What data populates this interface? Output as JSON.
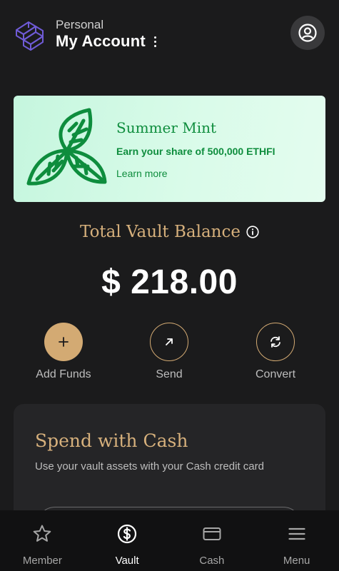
{
  "header": {
    "account_type": "Personal",
    "account_name": "My Account"
  },
  "promo": {
    "title": "Summer Mint",
    "subtitle": "Earn your share of 500,000 ETHFI",
    "link": "Learn more",
    "accent_color": "#0e8d3d"
  },
  "balance": {
    "label": "Total Vault Balance",
    "amount": "$ 218.00"
  },
  "actions": [
    {
      "label": "Add Funds",
      "icon": "plus-icon"
    },
    {
      "label": "Send",
      "icon": "arrow-up-right-icon"
    },
    {
      "label": "Convert",
      "icon": "refresh-icon"
    }
  ],
  "cash_card": {
    "title": "Spend with Cash",
    "description": "Use your vault assets with your Cash credit card"
  },
  "tabs": [
    {
      "label": "Member",
      "icon": "star-icon",
      "active": false
    },
    {
      "label": "Vault",
      "icon": "dollar-circle-icon",
      "active": true
    },
    {
      "label": "Cash",
      "icon": "card-icon",
      "active": false
    },
    {
      "label": "Menu",
      "icon": "menu-icon",
      "active": false
    }
  ],
  "colors": {
    "background": "#1b1b1c",
    "gold": "#d3aa73",
    "tabbar": "#111112"
  }
}
